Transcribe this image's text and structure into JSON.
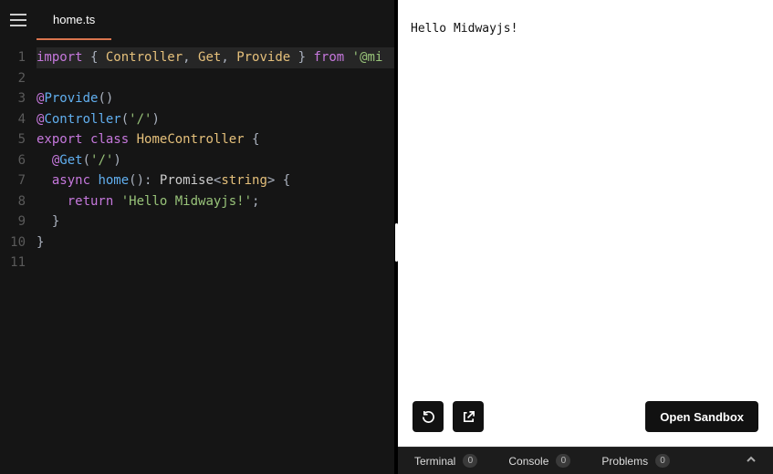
{
  "tabs": {
    "active": "home.ts"
  },
  "code": {
    "lines": [
      {
        "n": "1",
        "tokens": [
          {
            "t": "import",
            "c": "tk-kw"
          },
          {
            "t": " { ",
            "c": "tk-pun"
          },
          {
            "t": "Controller",
            "c": "tk-type"
          },
          {
            "t": ", ",
            "c": "tk-pun"
          },
          {
            "t": "Get",
            "c": "tk-type"
          },
          {
            "t": ", ",
            "c": "tk-pun"
          },
          {
            "t": "Provide",
            "c": "tk-type"
          },
          {
            "t": " } ",
            "c": "tk-pun"
          },
          {
            "t": "from",
            "c": "tk-kw"
          },
          {
            "t": " ",
            "c": "tk-pun"
          },
          {
            "t": "'@mi",
            "c": "tk-str"
          }
        ],
        "hl": true
      },
      {
        "n": "2",
        "tokens": [
          {
            "t": "",
            "c": "tk-pun"
          }
        ]
      },
      {
        "n": "3",
        "tokens": [
          {
            "t": "@",
            "c": "tk-dec-at"
          },
          {
            "t": "Provide",
            "c": "tk-dec"
          },
          {
            "t": "()",
            "c": "tk-pun"
          }
        ]
      },
      {
        "n": "4",
        "tokens": [
          {
            "t": "@",
            "c": "tk-dec-at"
          },
          {
            "t": "Controller",
            "c": "tk-dec"
          },
          {
            "t": "(",
            "c": "tk-pun"
          },
          {
            "t": "'/'",
            "c": "tk-str"
          },
          {
            "t": ")",
            "c": "tk-pun"
          }
        ]
      },
      {
        "n": "5",
        "tokens": [
          {
            "t": "export",
            "c": "tk-kw"
          },
          {
            "t": " ",
            "c": "tk-pun"
          },
          {
            "t": "class",
            "c": "tk-kw"
          },
          {
            "t": " ",
            "c": "tk-pun"
          },
          {
            "t": "HomeController",
            "c": "tk-type"
          },
          {
            "t": " {",
            "c": "tk-pun"
          }
        ]
      },
      {
        "n": "6",
        "tokens": [
          {
            "t": "  ",
            "c": "tk-pun"
          },
          {
            "t": "@",
            "c": "tk-dec-at"
          },
          {
            "t": "Get",
            "c": "tk-dec"
          },
          {
            "t": "(",
            "c": "tk-pun"
          },
          {
            "t": "'/'",
            "c": "tk-str"
          },
          {
            "t": ")",
            "c": "tk-pun"
          }
        ]
      },
      {
        "n": "7",
        "tokens": [
          {
            "t": "  ",
            "c": "tk-pun"
          },
          {
            "t": "async",
            "c": "tk-kw"
          },
          {
            "t": " ",
            "c": "tk-pun"
          },
          {
            "t": "home",
            "c": "tk-func"
          },
          {
            "t": "(): ",
            "c": "tk-pun"
          },
          {
            "t": "Promise",
            "c": "tk-white"
          },
          {
            "t": "<",
            "c": "tk-pun"
          },
          {
            "t": "string",
            "c": "tk-type"
          },
          {
            "t": "> {",
            "c": "tk-pun"
          }
        ]
      },
      {
        "n": "8",
        "tokens": [
          {
            "t": "    ",
            "c": "tk-pun"
          },
          {
            "t": "return",
            "c": "tk-kw"
          },
          {
            "t": " ",
            "c": "tk-pun"
          },
          {
            "t": "'Hello Midwayjs!'",
            "c": "tk-str"
          },
          {
            "t": ";",
            "c": "tk-pun"
          }
        ]
      },
      {
        "n": "9",
        "tokens": [
          {
            "t": "  }",
            "c": "tk-pun"
          }
        ]
      },
      {
        "n": "10",
        "tokens": [
          {
            "t": "}",
            "c": "tk-pun"
          }
        ]
      },
      {
        "n": "11",
        "tokens": [
          {
            "t": "",
            "c": "tk-pun"
          }
        ]
      }
    ]
  },
  "preview": {
    "output": "Hello Midwayjs!",
    "open_label": "Open Sandbox"
  },
  "panels": {
    "terminal": {
      "label": "Terminal",
      "count": "0"
    },
    "console": {
      "label": "Console",
      "count": "0"
    },
    "problems": {
      "label": "Problems",
      "count": "0"
    }
  }
}
